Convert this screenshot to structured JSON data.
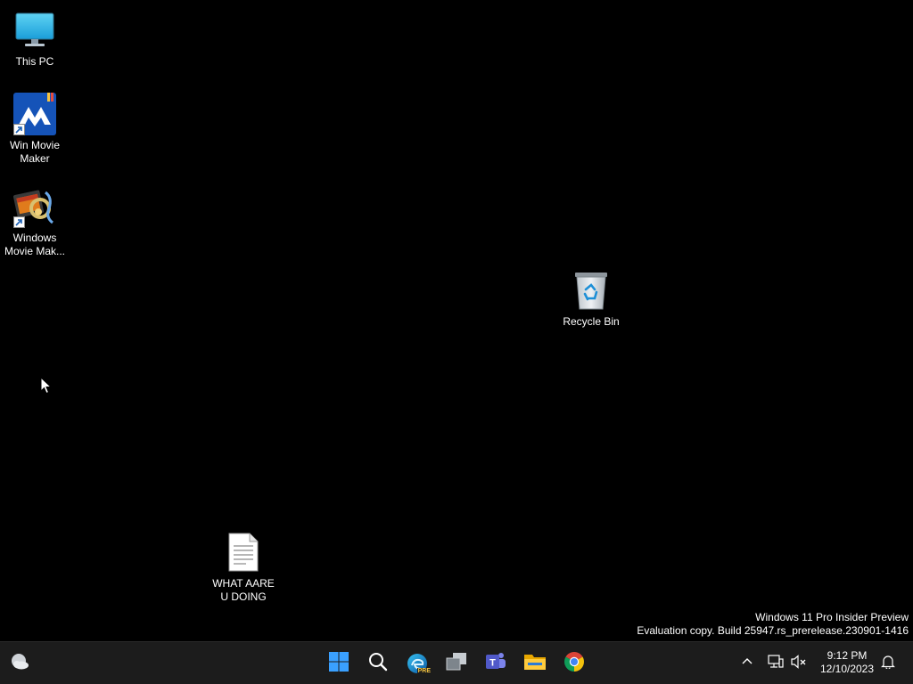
{
  "desktop": {
    "icons": {
      "this_pc": {
        "label": "This PC",
        "icon": "monitor-icon"
      },
      "win_movie_maker": {
        "label": "Win Movie Maker",
        "icon": "win-movie-maker-icon"
      },
      "windows_movie_maker": {
        "label": "Windows Movie Mak...",
        "icon": "windows-movie-maker-icon"
      },
      "recycle_bin": {
        "label": "Recycle Bin",
        "icon": "recycle-bin-icon"
      },
      "text_file": {
        "label": "WHAT AARE U DOING",
        "icon": "text-document-icon"
      }
    },
    "watermark": {
      "line1": "Windows 11 Pro Insider Preview",
      "line2": "Evaluation copy. Build 25947.rs_prerelease.230901-1416"
    }
  },
  "taskbar": {
    "widgets": "weather-widget-icon",
    "pinned": [
      "start-icon",
      "search-icon",
      "edge-icon",
      "task-view-icon",
      "teams-icon",
      "file-explorer-icon",
      "chrome-icon"
    ],
    "edge_badge": "PRE",
    "tray": {
      "icons": [
        "chevron-up-icon",
        "network-icon",
        "volume-muted-icon",
        "notification-bell-icon"
      ],
      "time": "9:12 PM",
      "date": "12/10/2023"
    }
  },
  "colors": {
    "desktop_bg": "#000000",
    "taskbar_bg": "#1c1c1c",
    "accent": "#0078d4"
  }
}
